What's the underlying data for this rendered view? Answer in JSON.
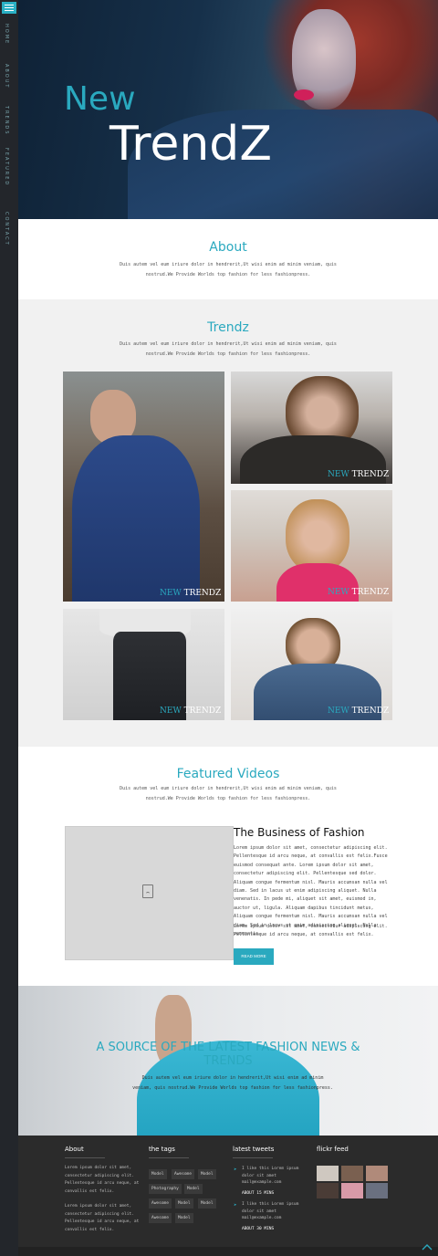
{
  "nav": {
    "items": [
      "Home",
      "About",
      "Trends",
      "Featured",
      "Contact"
    ]
  },
  "hero": {
    "new": "New",
    "trendz": "TrendZ"
  },
  "about": {
    "title": "About",
    "text": "Duis autem vel eum iriure dolor in hendrerit,Ut wisi enim ad minim veniam, quis nostrud.We Provide Worlds top fashion for less fashionpress."
  },
  "trendz": {
    "title": "Trendz",
    "text": "Duis autem vel eum iriure dolor in hendrerit,Ut wisi enim ad minim veniam, quis nostrud.We Provide Worlds top fashion for less fashionpress.",
    "caption_new": "NEW",
    "caption_trendz": "TRENDZ"
  },
  "videos": {
    "title": "Featured Videos",
    "text": "Duis autem vel eum iriure dolor in hendrerit,Ut wisi enim ad minim veniam, quis nostrud.We Provide Worlds top fashion for less fashionpress.",
    "article_title": "The Business of Fashion",
    "article_p1": "Lorem ipsum dolor sit amet, consectetur adipiscing elit. Pellentesque id arcu neque, at convallis est felix.Fusce euismod consequat ante. Lorem ipsum dolor sit amet, consectetur adipiscing elit. Pellentesque sed dolor. Aliquam congue fermentum nisl. Mauris accumsan nulla vel diam. Sed in lacus ut enim adipiscing aliquet. Nulla venenatis. In pede mi, aliquet sit amet, euismod in, auctor ut, ligula. Aliquam dapibus tincidunt metus, Aliquam congue fermentum nisl. Mauris accumsan nulla vel diam. Sed in lacus ut enim adipiscing aliquet. Nulla venenatis.",
    "article_p2": "Lorem ipsum dolor sit amet, consectetur adipiscing elit. Pellentesque id arcu neque, at convallis est felix.",
    "read_more": "READ MORE"
  },
  "banner": {
    "title": "A SOURCE OF THE LATEST FASHION NEWS & TRENDS",
    "text": "Duis autem vel eum iriure dolor in hendrerit,Ut wisi enim ad minim veniam, quis nostrud.We Provide Worlds top fashion for less fashionpress."
  },
  "footer": {
    "about_title": "About",
    "about_p1": "Lorem ipsum dolor sit amet, consectetur adipiscing elit. Pellentesque id arcu neque, at convallis est felix.",
    "about_p2": "Lorem ipsum dolor sit amet, consectetur adipiscing elit. Pellentesque id arcu neque, at convallis est felix.",
    "tags_title": "the tags",
    "tags": [
      "Model",
      "Awesome",
      "Model",
      "Photography",
      "Model",
      "Awesome",
      "Model",
      "Model",
      "Awesome",
      "Model"
    ],
    "tweets_title": "latest tweets",
    "tweet1_text": "I like this Lorem ipsum dolor sit amet mail@example.com",
    "tweet1_time": "ABOUT 15 MINS",
    "tweet2_text": "I like this Lorem ipsum dolor sit amet mail@example.com",
    "tweet2_time": "ABOUT 30 MINS",
    "flickr_title": "flickr feed"
  },
  "colors": {
    "accent": "#2aa9bf",
    "nav_bg": "#23262b",
    "footer_bg": "#2b2b2b",
    "section_bg": "#f1f1f1"
  }
}
